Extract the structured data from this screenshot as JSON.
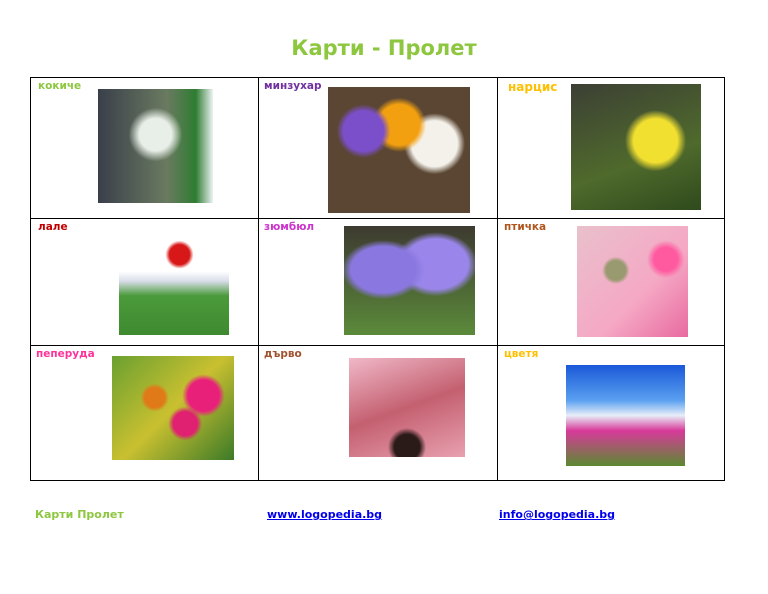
{
  "title": "Карти - Пролет",
  "cards": [
    {
      "label": "кокиче",
      "color": "#8dc63f",
      "image": "snowdrop"
    },
    {
      "label": "минзухар",
      "color": "#7030a0",
      "image": "crocus"
    },
    {
      "label": "нарцис",
      "color": "#ffc000",
      "image": "daffodil"
    },
    {
      "label": "лале",
      "color": "#c00000",
      "image": "tulip"
    },
    {
      "label": "зюмбюл",
      "color": "#cc33cc",
      "image": "hyacinth"
    },
    {
      "label": "птичка",
      "color": "#b0561e",
      "image": "bird"
    },
    {
      "label": "пеперуда",
      "color": "#ff3399",
      "image": "butterfly"
    },
    {
      "label": "дърво",
      "color": "#a0522d",
      "image": "blossom-tree"
    },
    {
      "label": "цветя",
      "color": "#ffc000",
      "image": "cosmos-flowers"
    }
  ],
  "footer": {
    "name": "Карти Пролет",
    "website": "www.logopedia.bg",
    "email": "info@logopedia.bg"
  }
}
